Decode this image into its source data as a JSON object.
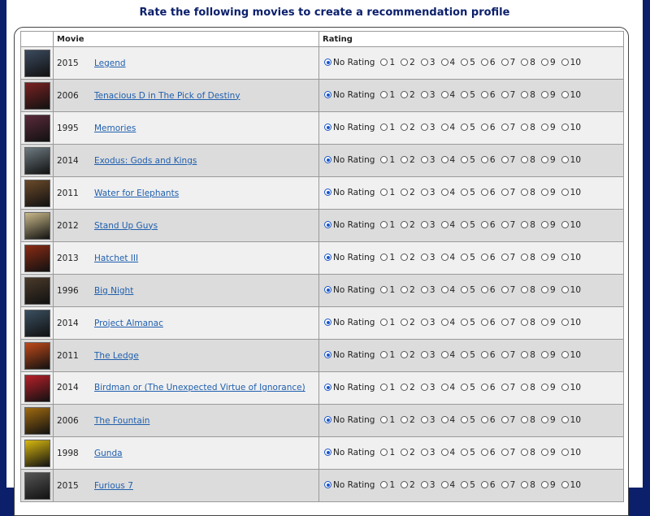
{
  "heading": "Rate the following movies to create a recommendation profile",
  "columns": {
    "blank": "",
    "movie": "Movie",
    "rating": "Rating"
  },
  "rating_options": [
    "No Rating",
    "1",
    "2",
    "3",
    "4",
    "5",
    "6",
    "7",
    "8",
    "9",
    "10"
  ],
  "selected_rating": "No Rating",
  "movies": [
    {
      "year": "2015",
      "title": "Legend",
      "poster_color": "#3b4a5e"
    },
    {
      "year": "2006",
      "title": "Tenacious D in The Pick of Destiny",
      "poster_color": "#7a2222"
    },
    {
      "year": "1995",
      "title": "Memories",
      "poster_color": "#5a2a3a"
    },
    {
      "year": "2014",
      "title": "Exodus: Gods and Kings",
      "poster_color": "#6d7a80"
    },
    {
      "year": "2011",
      "title": "Water for Elephants",
      "poster_color": "#6b4a2a"
    },
    {
      "year": "2012",
      "title": "Stand Up Guys",
      "poster_color": "#c9b98a"
    },
    {
      "year": "2013",
      "title": "Hatchet III",
      "poster_color": "#8a2b14"
    },
    {
      "year": "1996",
      "title": "Big Night",
      "poster_color": "#4a3a2a"
    },
    {
      "year": "2014",
      "title": "Project Almanac",
      "poster_color": "#3a4f60"
    },
    {
      "year": "2011",
      "title": "The Ledge",
      "poster_color": "#c04a1a"
    },
    {
      "year": "2014",
      "title": "Birdman or (The Unexpected Virtue of Ignorance)",
      "poster_color": "#b8202a"
    },
    {
      "year": "2006",
      "title": "The Fountain",
      "poster_color": "#a06a10"
    },
    {
      "year": "1998",
      "title": "Gunda",
      "poster_color": "#d8b810"
    },
    {
      "year": "2015",
      "title": "Furious 7",
      "poster_color": "#555555"
    }
  ],
  "colors": {
    "page_background": "#0b1f6b",
    "link": "#1f5fae",
    "radio_selected": "#1a56c8"
  }
}
